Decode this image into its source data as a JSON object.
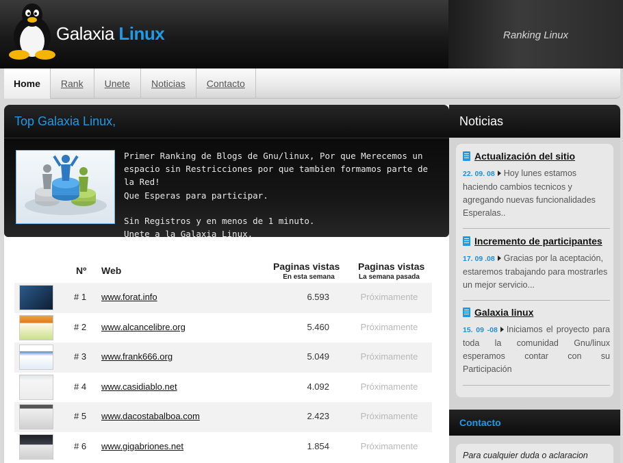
{
  "header": {
    "brand_left": "Galaxia",
    "brand_right": "Linux",
    "tagline": "Ranking Linux",
    "logo_icon": "tux-penguin-icon"
  },
  "nav": {
    "items": [
      {
        "label": "Home",
        "active": true
      },
      {
        "label": "Rank",
        "active": false
      },
      {
        "label": "Unete",
        "active": false
      },
      {
        "label": "Noticias",
        "active": false
      },
      {
        "label": "Contacto",
        "active": false
      }
    ]
  },
  "main": {
    "title": "Top Galaxia Linux,",
    "intro_icon": "people-podium-icon",
    "intro_paragraph1": "Primer Ranking de Blogs de Gnu/linux, Por que Merecemos un espacio sin Restricciones por que tambien formamos parte de la Red!\nQue Esperas para participar.",
    "intro_paragraph2": "Sin Registros y en menos de 1 minuto.\nUnete a la Galaxia Linux."
  },
  "ranking": {
    "col_num": "Nº",
    "col_web": "Web",
    "col_views_week": "Paginas vistas",
    "col_views_week_sub": "En esta semana",
    "col_views_last": "Paginas vistas",
    "col_views_last_sub": "La semana pasada",
    "rows": [
      {
        "rank": "# 1",
        "site": "www.forat.info",
        "views": "6.593",
        "last": "Próximamente",
        "thumb_color": "#1b3a5c"
      },
      {
        "rank": "# 2",
        "site": "www.alcancelibre.org",
        "views": "5.460",
        "last": "Próximamente",
        "thumb_color": "#e07b1a"
      },
      {
        "rank": "# 3",
        "site": "www.frank666.org",
        "views": "5.049",
        "last": "Próximamente",
        "thumb_color": "#5a86c8"
      },
      {
        "rank": "# 4",
        "site": "www.casidiablo.net",
        "views": "4.092",
        "last": "Próximamente",
        "thumb_color": "#e6e6e6"
      },
      {
        "rank": "# 5",
        "site": "www.dacostabalboa.com",
        "views": "2.423",
        "last": "Próximamente",
        "thumb_color": "#c9c9c9"
      },
      {
        "rank": "# 6",
        "site": "www.gigabriones.net",
        "views": "1.854",
        "last": "Próximamente",
        "thumb_color": "#2e3138"
      }
    ]
  },
  "sidebar": {
    "title": "Noticias",
    "news": [
      {
        "title": "Actualización del sitio",
        "date": "22. 09. 08",
        "text": "Hoy lunes estamos haciendo cambios tecnicos y agregando nuevas funcionalidades Esperalas..",
        "icon": "document-icon"
      },
      {
        "title": "Incremento de participantes",
        "date": "17. 09 .08",
        "text": "Gracias por la aceptación, estaremos trabajando para mostrarles un mejor servicio...",
        "icon": "document-icon"
      },
      {
        "title": "Galaxia linux",
        "date": "15. 09 -08",
        "text": "Iniciamos el proyecto para toda la comunidad Gnu/linux esperamos contar con su Participación",
        "icon": "document-icon"
      }
    ],
    "contact_title": "Contacto",
    "contact_text": "Para cualquier duda o aclaracion"
  },
  "colors": {
    "accent": "#1e9be8",
    "dark_band": "#0d0d0d",
    "placeholder_gray": "#b8b8b8"
  }
}
